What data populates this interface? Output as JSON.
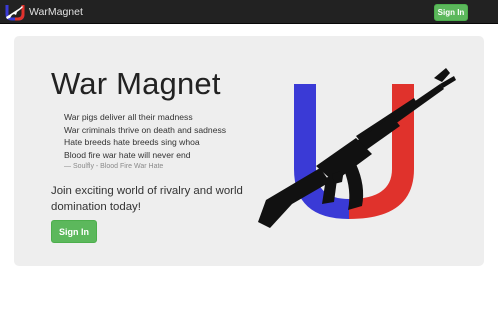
{
  "navbar": {
    "brand_name": "WarMagnet",
    "logo_icon": "war-magnet-logo-icon",
    "signin_label": "Sign In",
    "background_color": "#222222"
  },
  "hero": {
    "title": "War Magnet",
    "quote_lines": [
      "War pigs deliver all their madness",
      "War criminals thrive on death and sadness",
      "Hate breeds hate breeds sing whoa",
      "Blood fire war hate will never end"
    ],
    "quote_cite": "— Soulfly - Blood Fire War Hate",
    "tagline": "Join exciting world of rivalry and world domination today!",
    "signin_label": "Sign In",
    "art_icon": "magnet-rifle-icon",
    "background_color": "#eeeeee"
  },
  "colors": {
    "accent_green": "#5cb85c",
    "magnet_blue": "#3a3ad6",
    "magnet_red": "#e0322c",
    "rifle_black": "#111111"
  }
}
